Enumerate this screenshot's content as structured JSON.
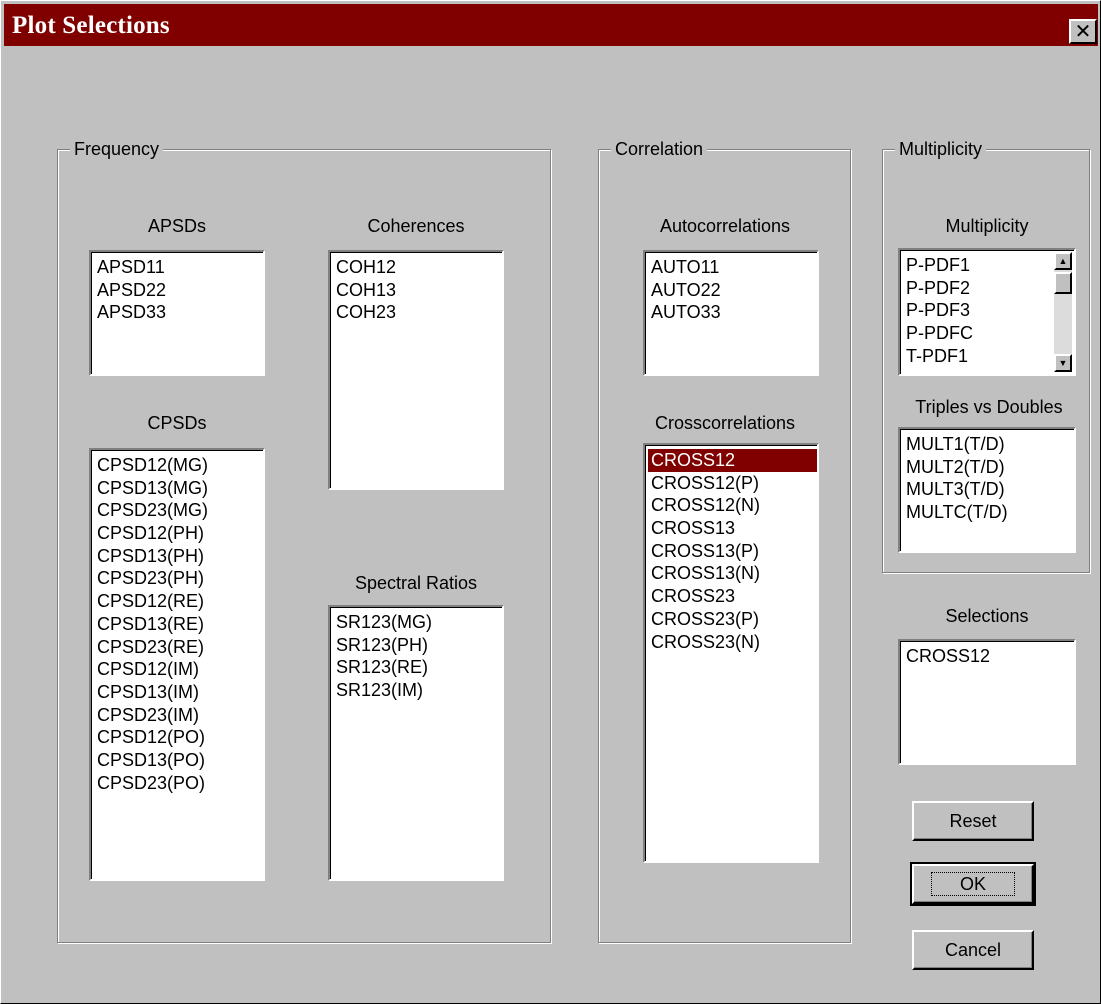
{
  "window": {
    "title": "Plot Selections",
    "close_label": "✕"
  },
  "frequency": {
    "group_title": "Frequency",
    "apsds": {
      "label": "APSDs",
      "items": [
        "APSD11",
        "APSD22",
        "APSD33"
      ]
    },
    "coherences": {
      "label": "Coherences",
      "items": [
        "COH12",
        "COH13",
        "COH23"
      ]
    },
    "cpsds": {
      "label": "CPSDs",
      "items": [
        "CPSD12(MG)",
        "CPSD13(MG)",
        "CPSD23(MG)",
        "CPSD12(PH)",
        "CPSD13(PH)",
        "CPSD23(PH)",
        "CPSD12(RE)",
        "CPSD13(RE)",
        "CPSD23(RE)",
        "CPSD12(IM)",
        "CPSD13(IM)",
        "CPSD23(IM)",
        "CPSD12(PO)",
        "CPSD13(PO)",
        "CPSD23(PO)"
      ]
    },
    "spectral_ratios": {
      "label": "Spectral Ratios",
      "items": [
        "SR123(MG)",
        "SR123(PH)",
        "SR123(RE)",
        "SR123(IM)"
      ]
    }
  },
  "correlation": {
    "group_title": "Correlation",
    "autocorrelations": {
      "label": "Autocorrelations",
      "items": [
        "AUTO11",
        "AUTO22",
        "AUTO33"
      ]
    },
    "crosscorrelations": {
      "label": "Crosscorrelations",
      "items": [
        "CROSS12",
        "CROSS12(P)",
        "CROSS12(N)",
        "CROSS13",
        "CROSS13(P)",
        "CROSS13(N)",
        "CROSS23",
        "CROSS23(P)",
        "CROSS23(N)"
      ],
      "selected": "CROSS12"
    }
  },
  "multiplicity": {
    "group_title": "Multiplicity",
    "multiplicity_list": {
      "label": "Multiplicity",
      "items": [
        "P-PDF1",
        "P-PDF2",
        "P-PDF3",
        "P-PDFC",
        "T-PDF1"
      ]
    },
    "triples_vs_doubles": {
      "label": "Triples vs Doubles",
      "items": [
        "MULT1(T/D)",
        "MULT2(T/D)",
        "MULT3(T/D)",
        "MULTC(T/D)"
      ]
    }
  },
  "selections": {
    "label": "Selections",
    "items": [
      "CROSS12"
    ]
  },
  "buttons": {
    "reset": "Reset",
    "ok": "OK",
    "cancel": "Cancel"
  },
  "colors": {
    "title_bar": "#800000",
    "selection_highlight": "#800000",
    "face": "#c0c0c0"
  }
}
